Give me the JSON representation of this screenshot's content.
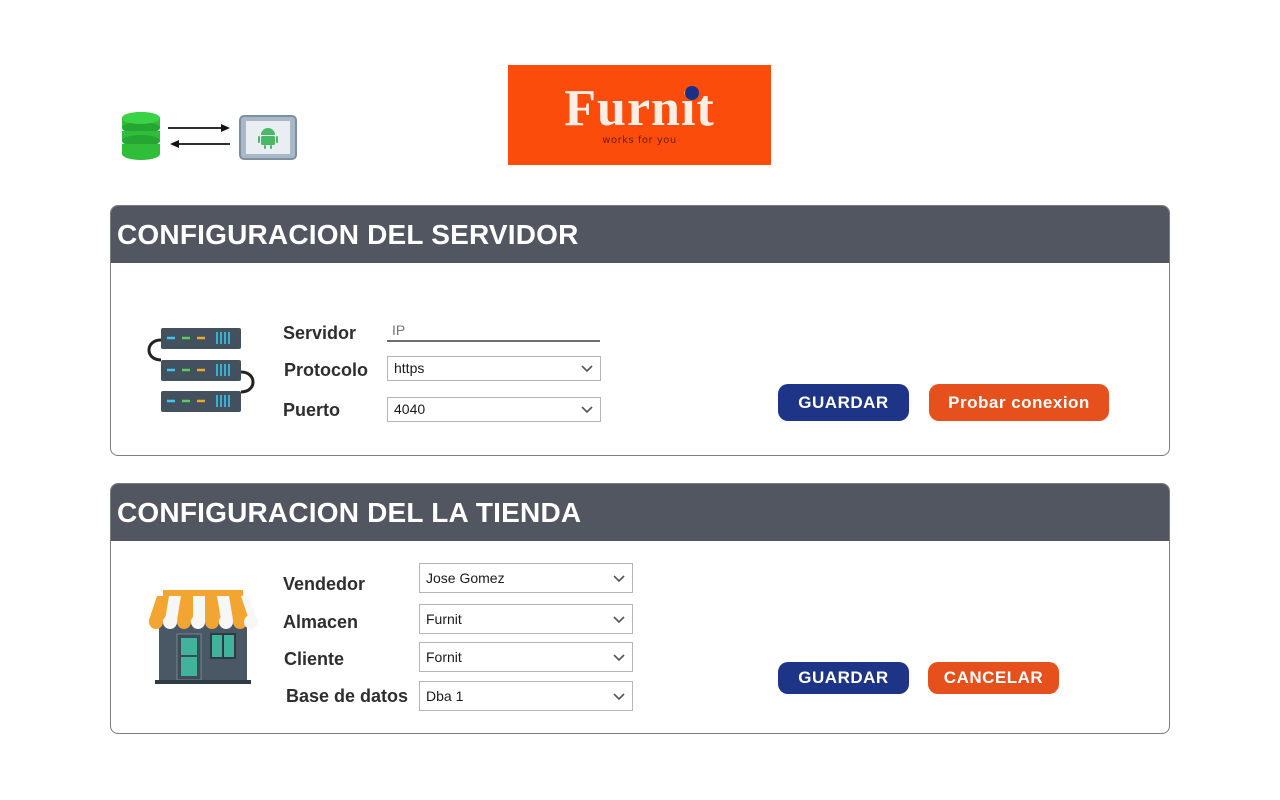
{
  "logo": {
    "word": "Furnit",
    "tagline": "works for you"
  },
  "icons": {
    "sync": "database-sync-android-icon",
    "server": "server-rack-icon",
    "store": "storefront-icon",
    "chevron": "chevron-down-icon"
  },
  "colors": {
    "header_bg": "#525660",
    "primary_button": "#1d3487",
    "secondary_button": "#e5501c",
    "logo_bg": "#fb4c0c"
  },
  "server_panel": {
    "title": "CONFIGURACION DEL SERVIDOR",
    "fields": {
      "servidor": {
        "label": "Servidor",
        "placeholder": "IP",
        "value": ""
      },
      "protocolo": {
        "label": "Protocolo",
        "value": "https"
      },
      "puerto": {
        "label": "Puerto",
        "value": "4040"
      }
    },
    "buttons": {
      "save": "GUARDAR",
      "test": "Probar conexion"
    }
  },
  "store_panel": {
    "title": "CONFIGURACION DEL LA TIENDA",
    "fields": {
      "vendedor": {
        "label": "Vendedor",
        "value": "Jose Gomez"
      },
      "almacen": {
        "label": "Almacen",
        "value": "Furnit"
      },
      "cliente": {
        "label": "Cliente",
        "value": "Fornit"
      },
      "base_datos": {
        "label": "Base de datos",
        "value": "Dba 1"
      }
    },
    "buttons": {
      "save": "GUARDAR",
      "cancel": "CANCELAR"
    }
  }
}
